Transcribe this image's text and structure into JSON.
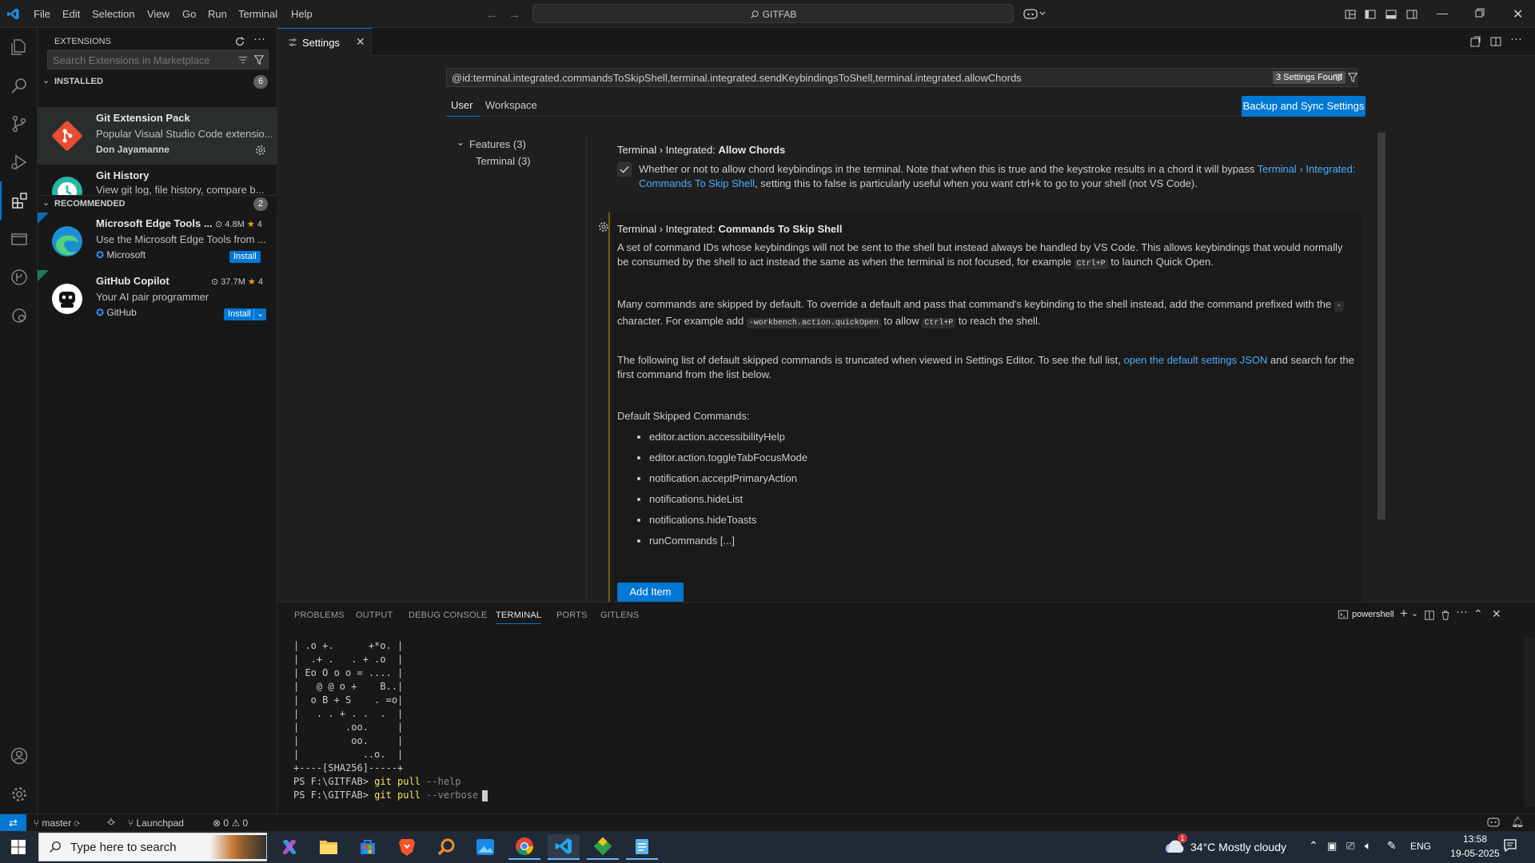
{
  "menu": [
    "File",
    "Edit",
    "Selection",
    "View",
    "Go",
    "Run",
    "Terminal",
    "Help"
  ],
  "command_center": "GITFAB",
  "sidebar": {
    "title": "EXTENSIONS",
    "search_placeholder": "Search Extensions in Marketplace",
    "installed_label": "INSTALLED",
    "installed_count": "6",
    "recommended_label": "RECOMMENDED",
    "recommended_count": "2",
    "installed": [
      {
        "name": "Git Extension Pack",
        "desc": "Popular Visual Studio Code extensio...",
        "publisher": "Don Jayamanne"
      },
      {
        "name": "Git History",
        "desc": "View git log, file history, compare b..."
      }
    ],
    "recommended": [
      {
        "name": "Microsoft Edge Tools ...",
        "downloads": "4.8M",
        "rating": "4",
        "desc": "Use the Microsoft Edge Tools from ...",
        "publisher": "Microsoft",
        "action": "Install"
      },
      {
        "name": "GitHub Copilot",
        "downloads": "37.7M",
        "rating": "4",
        "desc": "Your AI pair programmer",
        "publisher": "GitHub",
        "action": "Install"
      }
    ]
  },
  "tab": {
    "label": "Settings"
  },
  "settings": {
    "search_value": "@id:terminal.integrated.commandsToSkipShell,terminal.integrated.sendKeybindingsToShell,terminal.integrated.allowChords",
    "found": "3 Settings Found",
    "scope_tabs": [
      "User",
      "Workspace"
    ],
    "backup_button": "Backup and Sync Settings",
    "toc": {
      "features": "Features (3)",
      "terminal": "Terminal (3)"
    },
    "allow_chords": {
      "prefix": "Terminal › Integrated: ",
      "name": "Allow Chords",
      "desc1": "Whether or not to allow chord keybindings in the terminal. Note that when this is true and the keystroke results in a chord it will bypass ",
      "link": "Terminal › Integrated: Commands To Skip Shell",
      "desc2": ", setting this to false is particularly useful when you want ctrl+k to go to your shell (not VS Code)."
    },
    "skip_shell": {
      "prefix": "Terminal › Integrated: ",
      "name": "Commands To Skip Shell",
      "p1a": "A set of command IDs whose keybindings will not be sent to the shell but instead always be handled by VS Code. This allows keybindings that would normally be consumed by the shell to act instead the same as when the terminal is not focused, for example ",
      "p1code": "Ctrl+P",
      "p1b": " to launch Quick Open.",
      "p2a": "Many commands are skipped by default. To override a default and pass that command's keybinding to the shell instead, add the command prefixed with the ",
      "p2code1": "-",
      "p2b": " character. For example add ",
      "p2code2": "-workbench.action.quickOpen",
      "p2c": " to allow ",
      "p2code3": "Ctrl+P",
      "p2d": " to reach the shell.",
      "p3a": "The following list of default skipped commands is truncated when viewed in Settings Editor. To see the full list, ",
      "p3link": "open the default settings JSON",
      "p3b": " and search for the first command from the list below.",
      "default_label": "Default Skipped Commands:",
      "commands": [
        "editor.action.accessibilityHelp",
        "editor.action.toggleTabFocusMode",
        "notification.acceptPrimaryAction",
        "notifications.hideList",
        "notifications.hideToasts",
        "runCommands [...]"
      ],
      "add_item": "Add Item"
    }
  },
  "panel": {
    "tabs": [
      "PROBLEMS",
      "OUTPUT",
      "DEBUG CONSOLE",
      "TERMINAL",
      "PORTS",
      "GITLENS"
    ],
    "active_tab": "TERMINAL",
    "shell": "powershell",
    "terminal_lines": [
      "| .o +.      +*o. |",
      "|  .+ .   . + .o  |",
      "| Eo O o o = .... |",
      "|   @ @ o +    B..|",
      "|  o B + S    . =o|",
      "|   . . + . .  .  |",
      "|        .oo.     |",
      "|         oo.     |",
      "|           ..o.  |",
      "+----[SHA256]-----+"
    ],
    "prompt1": "PS F:\\GITFAB> ",
    "cmd1": "git pull",
    "arg1": " --help",
    "prompt2": "PS F:\\GITFAB> ",
    "cmd2": "git pull",
    "arg2": " --verbose"
  },
  "statusbar": {
    "branch": "master",
    "launchpad": "Launchpad",
    "errors": "0",
    "warnings": "0"
  },
  "taskbar": {
    "search_placeholder": "Type here to search",
    "weather_temp": "34°C",
    "weather_desc": "Mostly cloudy",
    "weather_badge": "1",
    "lang": "ENG",
    "time": "13:58",
    "date": "19-05-2025"
  },
  "colors": {
    "accent": "#0078d4",
    "link": "#4daafc",
    "bg": "#1f1f1f",
    "sidebar_bg": "#181818"
  }
}
